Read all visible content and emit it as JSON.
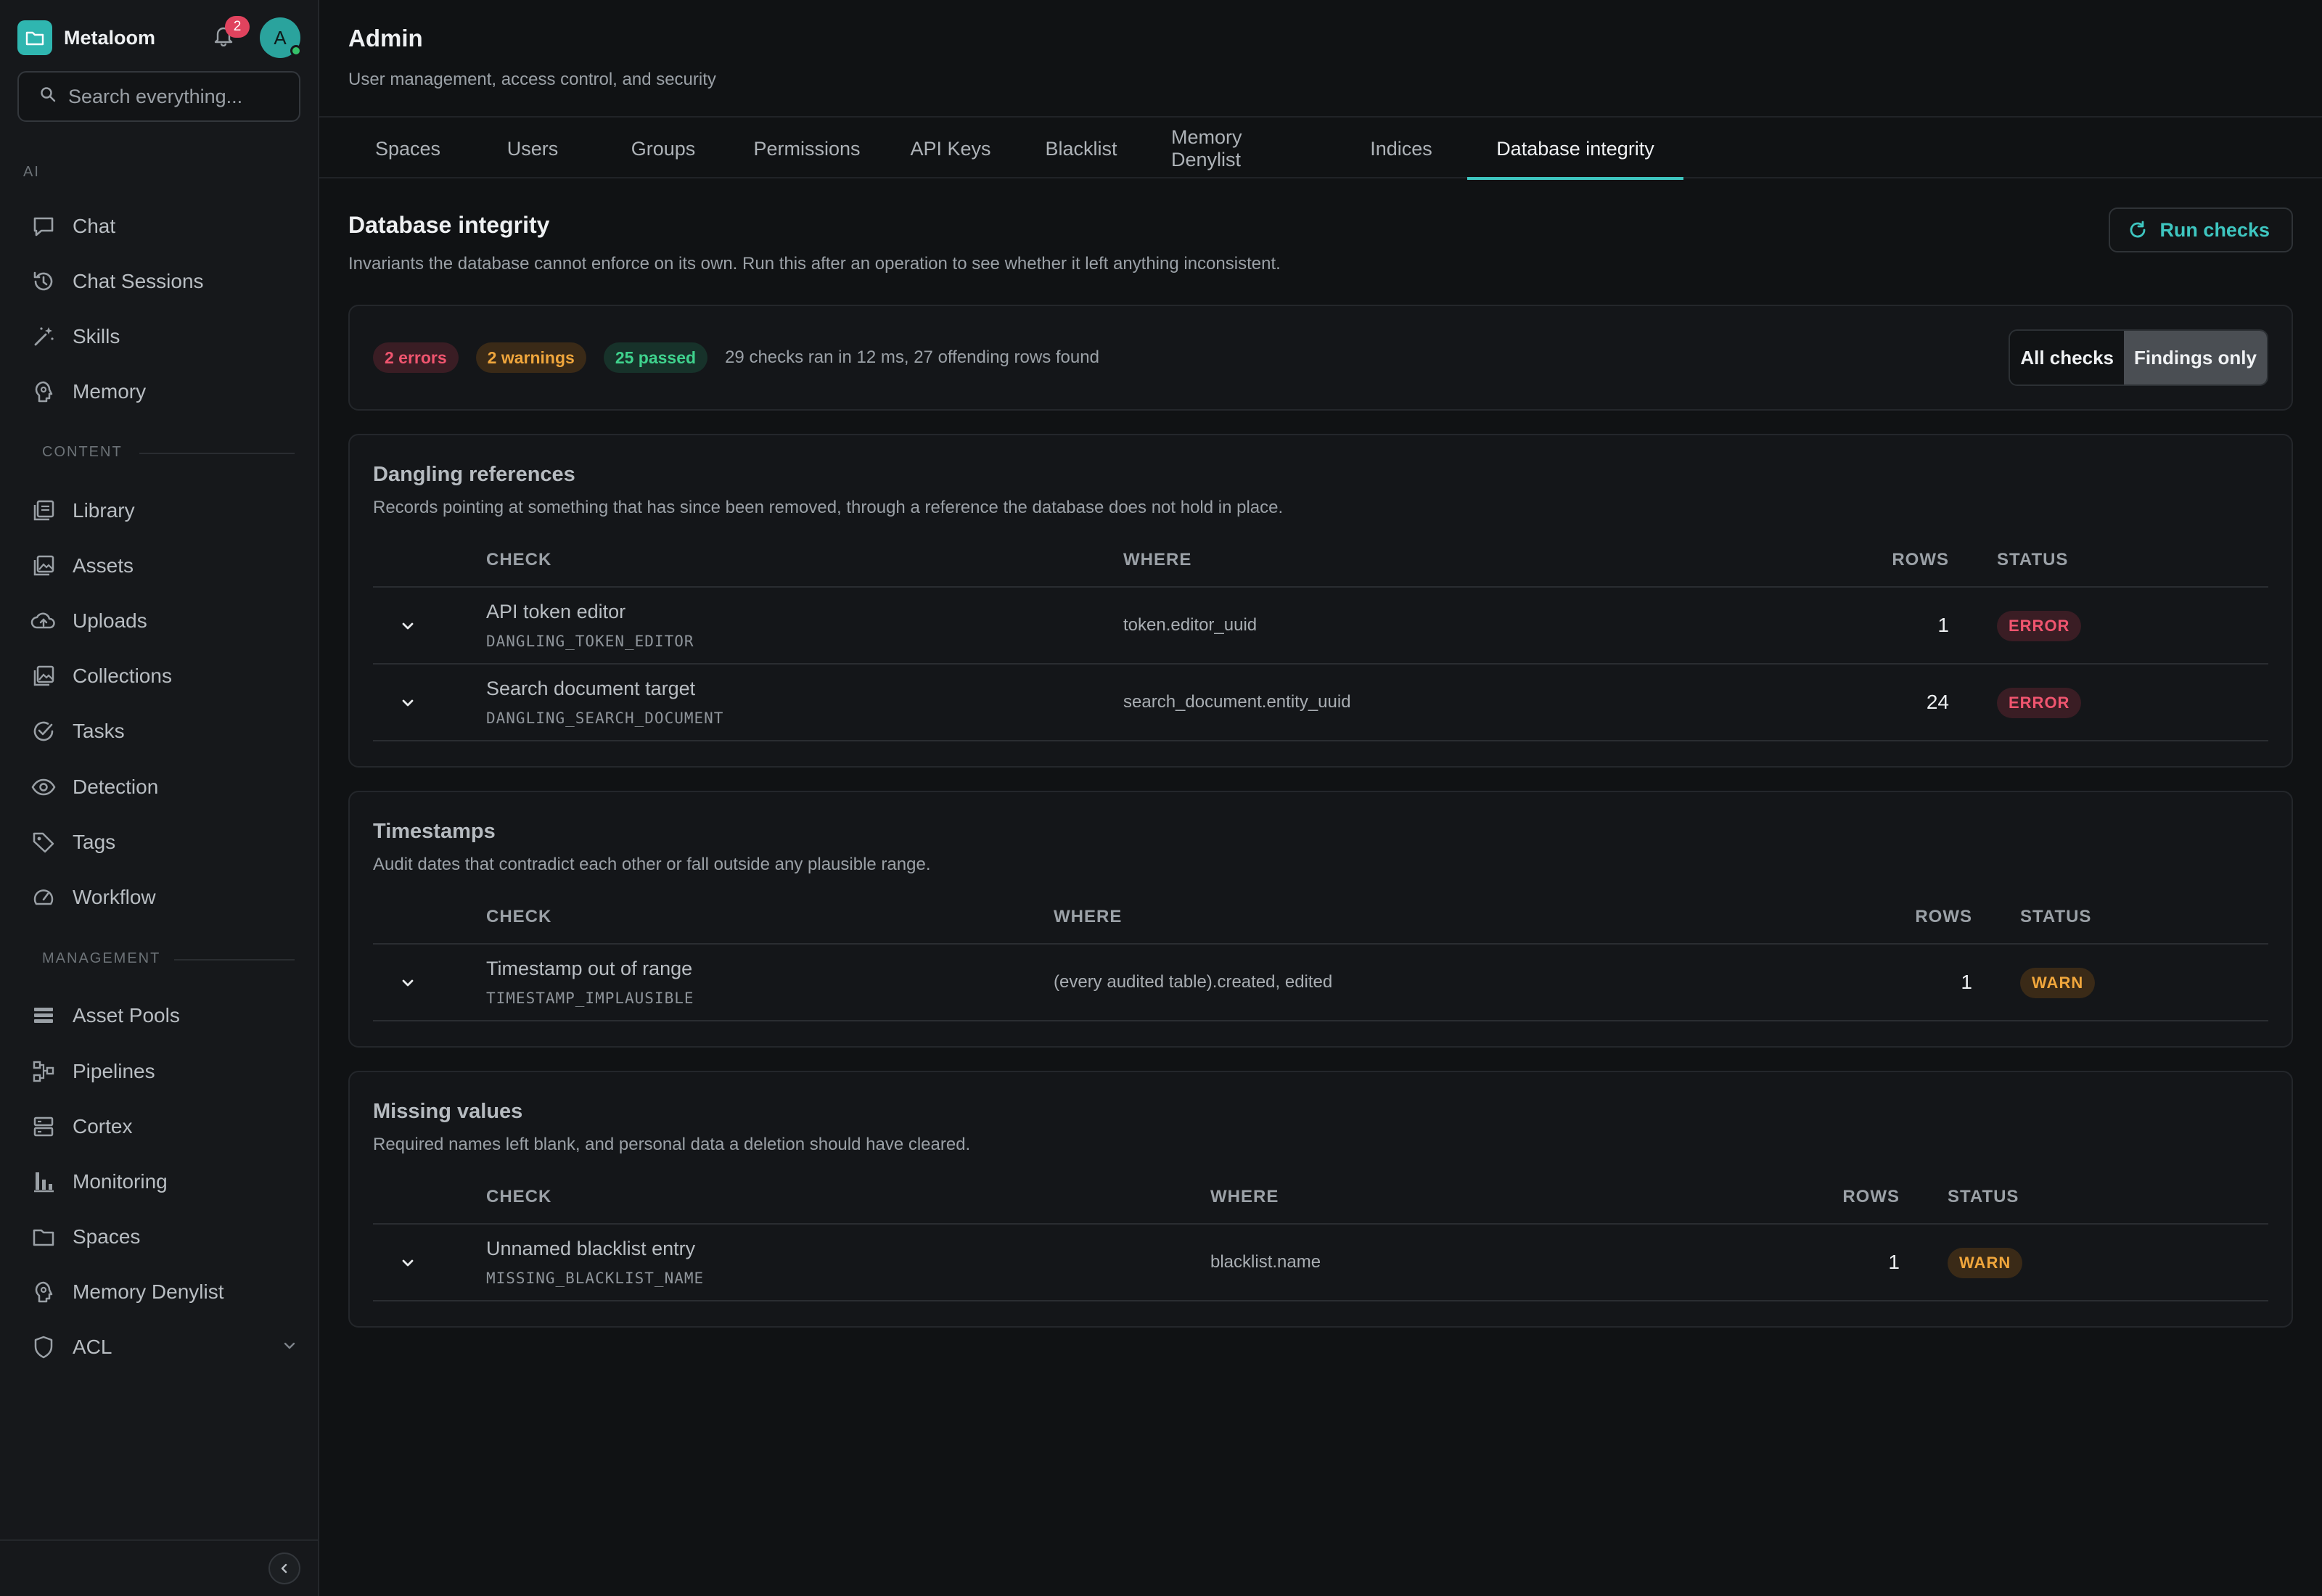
{
  "brand": {
    "name": "Metaloom",
    "notification_count": "2",
    "avatar_initial": "A"
  },
  "search": {
    "placeholder": "Search everything..."
  },
  "sidebar": {
    "section_ai": "AI",
    "section_content": "CONTENT",
    "section_management": "MANAGEMENT",
    "ai_items": [
      {
        "label": "Chat",
        "icon": "chat-icon"
      },
      {
        "label": "Chat Sessions",
        "icon": "history-icon"
      },
      {
        "label": "Skills",
        "icon": "magic-wand-icon"
      },
      {
        "label": "Memory",
        "icon": "brain-icon"
      }
    ],
    "content_items": [
      {
        "label": "Library",
        "icon": "library-icon"
      },
      {
        "label": "Assets",
        "icon": "image-icon"
      },
      {
        "label": "Uploads",
        "icon": "cloud-upload-icon"
      },
      {
        "label": "Collections",
        "icon": "collections-icon"
      },
      {
        "label": "Tasks",
        "icon": "check-circle-icon"
      },
      {
        "label": "Detection",
        "icon": "eye-icon"
      },
      {
        "label": "Tags",
        "icon": "tag-icon"
      },
      {
        "label": "Workflow",
        "icon": "gauge-icon"
      }
    ],
    "management_items": [
      {
        "label": "Asset Pools",
        "icon": "pool-icon"
      },
      {
        "label": "Pipelines",
        "icon": "pipeline-icon"
      },
      {
        "label": "Cortex",
        "icon": "server-icon"
      },
      {
        "label": "Monitoring",
        "icon": "bar-chart-icon"
      },
      {
        "label": "Spaces",
        "icon": "folder-icon"
      },
      {
        "label": "Memory Denylist",
        "icon": "brain-icon"
      },
      {
        "label": "ACL",
        "icon": "shield-icon"
      }
    ]
  },
  "header": {
    "title": "Admin",
    "subtitle": "User management, access control, and security"
  },
  "tabs": [
    {
      "label": "Spaces"
    },
    {
      "label": "Users"
    },
    {
      "label": "Groups"
    },
    {
      "label": "Permissions"
    },
    {
      "label": "API Keys"
    },
    {
      "label": "Blacklist"
    },
    {
      "label": "Memory Denylist"
    },
    {
      "label": "Indices"
    },
    {
      "label": "Database integrity",
      "active": true
    }
  ],
  "integrity": {
    "title": "Database integrity",
    "description": "Invariants the database cannot enforce on its own. Run this after an operation to see whether it left anything inconsistent.",
    "run_label": "Run checks",
    "errors_label": "2 errors",
    "warnings_label": "2 warnings",
    "passed_label": "25 passed",
    "summary_text": "29 checks ran in 12 ms, 27 offending rows found",
    "filter_all": "All checks",
    "filter_findings": "Findings only",
    "filter_selected": "Findings only"
  },
  "table_headers": {
    "check": "CHECK",
    "where": "WHERE",
    "rows": "ROWS",
    "status": "STATUS"
  },
  "groups": [
    {
      "title": "Dangling references",
      "description": "Records pointing at something that has since been removed, through a reference the database does not hold in place.",
      "rows": [
        {
          "name": "API token editor",
          "code": "DANGLING_TOKEN_EDITOR",
          "where": "token.editor_uuid",
          "rows": "1",
          "status": "ERROR"
        },
        {
          "name": "Search document target",
          "code": "DANGLING_SEARCH_DOCUMENT",
          "where": "search_document.entity_uuid",
          "rows": "24",
          "status": "ERROR"
        }
      ]
    },
    {
      "title": "Timestamps",
      "description": "Audit dates that contradict each other or fall outside any plausible range.",
      "rows": [
        {
          "name": "Timestamp out of range",
          "code": "TIMESTAMP_IMPLAUSIBLE",
          "where": "(every audited table).created, edited",
          "rows": "1",
          "status": "WARN"
        }
      ]
    },
    {
      "title": "Missing values",
      "description": "Required names left blank, and personal data a deletion should have cleared.",
      "rows": [
        {
          "name": "Unnamed blacklist entry",
          "code": "MISSING_BLACKLIST_NAME",
          "where": "blacklist.name",
          "rows": "1",
          "status": "WARN"
        }
      ]
    }
  ],
  "colors": {
    "accent": "#3ec6c0",
    "error": "#f0556f",
    "warning": "#f0a63c",
    "success": "#3fd28d"
  }
}
